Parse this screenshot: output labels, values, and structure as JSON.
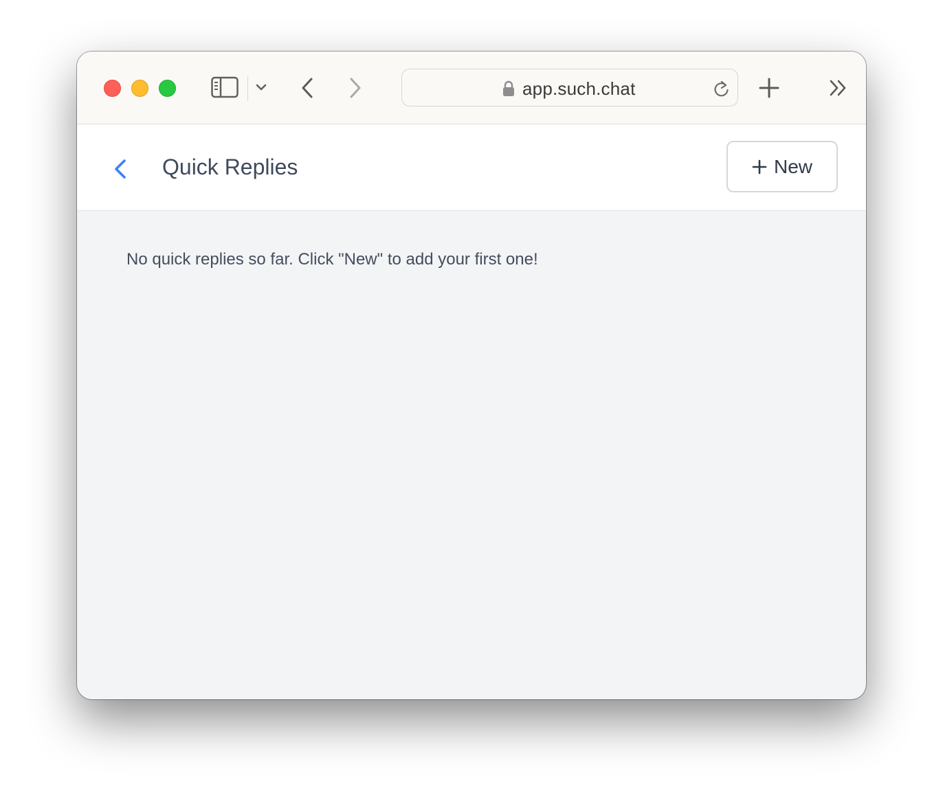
{
  "browser": {
    "url": "app.such.chat",
    "icons": {
      "sidebar_toggle": "sidebar-icon",
      "tab_overview": "chevron-down-icon",
      "back": "chevron-left-icon",
      "forward": "chevron-right-icon",
      "lock": "lock-icon",
      "reload": "reload-icon",
      "new_tab": "plus-icon",
      "more": "double-chevron-right-icon"
    }
  },
  "header": {
    "title": "Quick Replies",
    "new_button_label": "New",
    "accent_color": "#3b82f6"
  },
  "main": {
    "empty_message": "No quick replies so far. Click \"New\" to add your first one!"
  }
}
